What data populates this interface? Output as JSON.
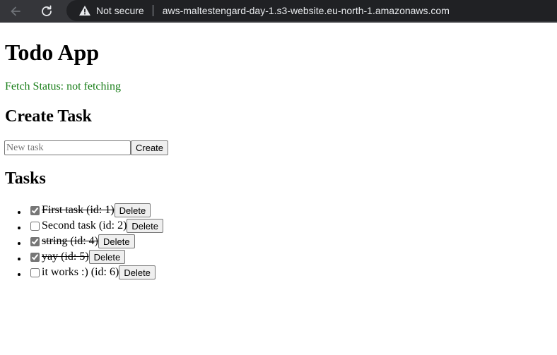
{
  "browser": {
    "not_secure_label": "Not secure",
    "url": "aws-maltestengard-day-1.s3-website.eu-north-1.amazonaws.com"
  },
  "app": {
    "title": "Todo App",
    "fetch_status": "Fetch Status: not fetching",
    "fetch_status_color": "#1a7f1a"
  },
  "create": {
    "heading": "Create Task",
    "input_placeholder": "New task",
    "input_value": "",
    "button_label": "Create"
  },
  "tasks": {
    "heading": "Tasks",
    "delete_label": "Delete",
    "items": [
      {
        "text": "First task (id: 1)",
        "done": true
      },
      {
        "text": "Second task (id: 2)",
        "done": false
      },
      {
        "text": "string (id: 4)",
        "done": true
      },
      {
        "text": "yay (id: 5)",
        "done": true
      },
      {
        "text": "it works :) (id: 6)",
        "done": false
      }
    ]
  }
}
